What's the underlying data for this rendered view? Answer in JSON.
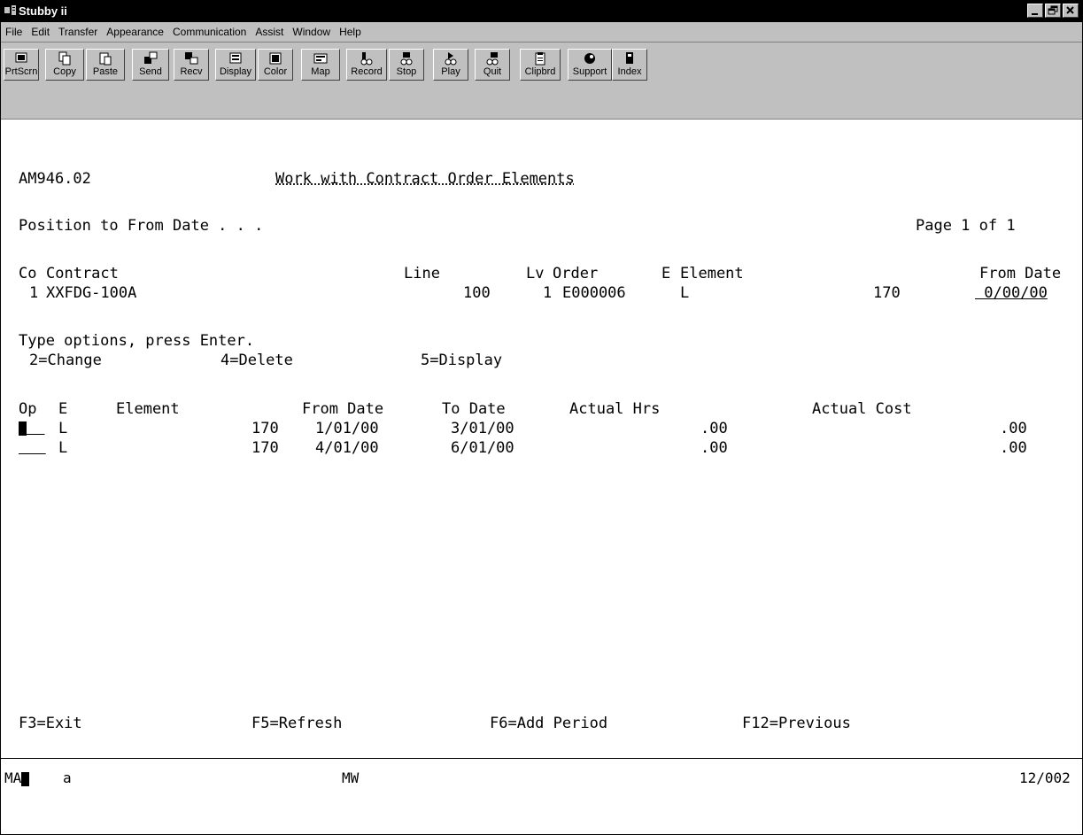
{
  "window": {
    "title": "Stubby ii"
  },
  "menu": [
    "File",
    "Edit",
    "Transfer",
    "Appearance",
    "Communication",
    "Assist",
    "Window",
    "Help"
  ],
  "toolbar": [
    {
      "label": "PrtScrn",
      "icon": "print-screen-icon"
    },
    {
      "label": "Copy",
      "icon": "copy-icon"
    },
    {
      "label": "Paste",
      "icon": "paste-icon"
    },
    {
      "label": "Send",
      "icon": "send-icon"
    },
    {
      "label": "Recv",
      "icon": "receive-icon"
    },
    {
      "label": "Display",
      "icon": "display-icon"
    },
    {
      "label": "Color",
      "icon": "color-icon"
    },
    {
      "label": "Map",
      "icon": "map-icon"
    },
    {
      "label": "Record",
      "icon": "record-icon"
    },
    {
      "label": "Stop",
      "icon": "stop-icon"
    },
    {
      "label": "Play",
      "icon": "play-icon"
    },
    {
      "label": "Quit",
      "icon": "quit-icon"
    },
    {
      "label": "Clipbrd",
      "icon": "clipboard-icon"
    },
    {
      "label": "Support",
      "icon": "support-icon"
    },
    {
      "label": "Index",
      "icon": "index-icon"
    }
  ],
  "screen": {
    "program_id": "AM946.02",
    "title": "Work with Contract Order Elements",
    "position_label": "Position to From Date . . .",
    "page": "Page 1 of 1",
    "header_cols": {
      "co": "Co",
      "contract": "Contract",
      "line": "Line",
      "lv": "Lv",
      "order": "Order",
      "e": "E",
      "element": "Element",
      "from_date": "From Date"
    },
    "header_values": {
      "co": "1",
      "contract": "XXFDG-100A",
      "line": "100",
      "lv": "1",
      "order": "E000006",
      "e": "L",
      "element": "170",
      "from_date": " 0/00/00"
    },
    "instructions": "Type options, press Enter.",
    "options": [
      "2=Change",
      "4=Delete",
      "5=Display"
    ],
    "table_cols": {
      "op": "Op",
      "e": "E",
      "element": "Element",
      "from_date": "From Date",
      "to_date": "To Date",
      "actual_hrs": "Actual Hrs",
      "actual_cost": "Actual Cost"
    },
    "rows": [
      {
        "e": "L",
        "element": "170",
        "from": "1/01/00",
        "to": "3/01/00",
        "hrs": ".00",
        "cost": ".00"
      },
      {
        "e": "L",
        "element": "170",
        "from": "4/01/00",
        "to": "6/01/00",
        "hrs": ".00",
        "cost": ".00"
      }
    ],
    "function_keys": [
      "F3=Exit",
      "F5=Refresh",
      "F6=Add Period",
      "F12=Previous"
    ]
  },
  "status": {
    "left": "MA",
    "mode": "a",
    "session": "MW",
    "position": "12/002"
  }
}
